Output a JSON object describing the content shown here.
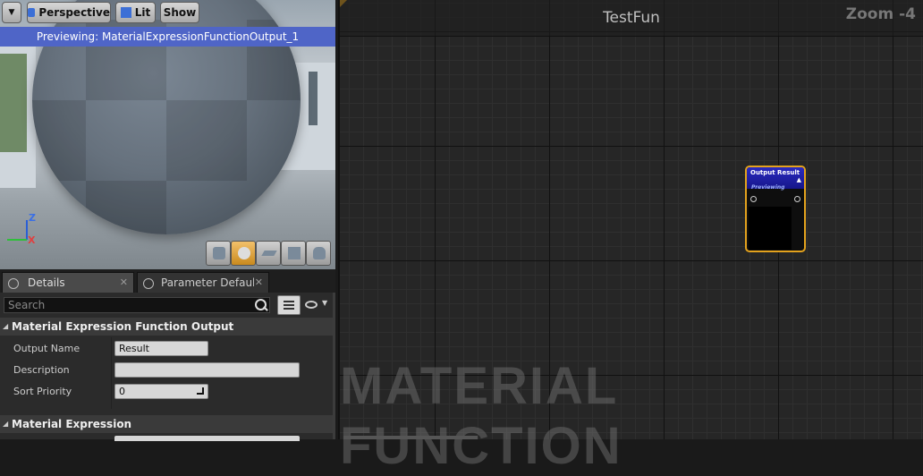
{
  "viewport": {
    "dropdown_icon": "chevron-down-icon",
    "perspective_label": "Perspective",
    "lit_label": "Lit",
    "show_label": "Show",
    "preview_banner": "Previewing: MaterialExpressionFunctionOutput_1",
    "axis_z": "Z",
    "axis_x": "X",
    "mode_buttons": [
      "cylinder-icon",
      "sphere-icon",
      "plane-icon",
      "cube-icon",
      "teapot-icon"
    ],
    "active_mode": "sphere-icon"
  },
  "panel": {
    "tabs": [
      {
        "label": "Details",
        "active": true,
        "icon": "details-icon"
      },
      {
        "label": "Parameter Defaults",
        "active": false,
        "icon": "parameter-icon"
      }
    ],
    "search_placeholder": "Search",
    "sections": [
      {
        "title": "Material Expression Function Output",
        "properties": [
          {
            "label": "Output Name",
            "value": "Result"
          },
          {
            "label": "Description",
            "value": ""
          },
          {
            "label": "Sort Priority",
            "value": "0"
          }
        ]
      },
      {
        "title": "Material Expression",
        "properties": []
      }
    ]
  },
  "graph": {
    "title": "TestFun",
    "zoom": "Zoom -4",
    "watermark": "MATERIAL FUNCTION",
    "node": {
      "title": "Output Result",
      "subtitle": "Previewing"
    }
  },
  "colors": {
    "banner": "#4f65c7",
    "node_border": "#e3a21d",
    "node_header": "#2a2ac0"
  }
}
